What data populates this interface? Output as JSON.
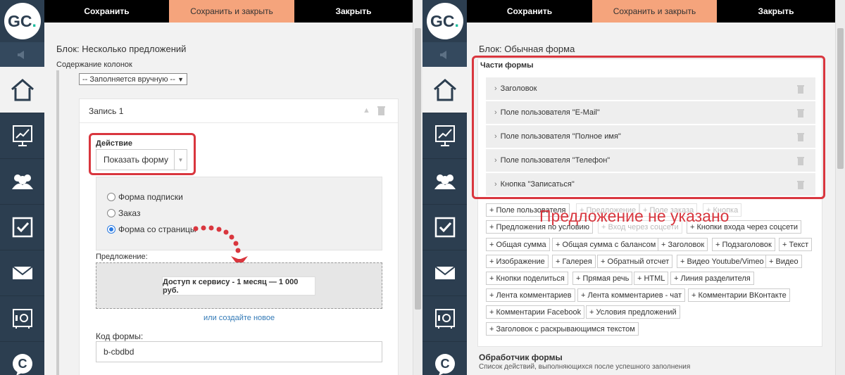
{
  "left": {
    "logo": "GC.",
    "toolbar": {
      "save": "Сохранить",
      "save_close": "Сохранить и закрыть",
      "close": "Закрыть"
    },
    "block_title": "Блок: Несколько предложений",
    "columns_label": "Содержание колонок",
    "columns_select": "-- Заполняется вручную --",
    "record_title": "Запись 1",
    "action_label": "Действие",
    "action_value": "Показать форму",
    "radio_options": [
      "Форма подписки",
      "Заказ",
      "Форма со страницы"
    ],
    "radio_selected": "Форма со страницы",
    "offer_label": "Предложение:",
    "offer_value": "Доступ к сервису - 1 месяц — 1 000 руб.",
    "create_new_link": "или создайте новое",
    "form_code_label": "Код формы:",
    "form_code_value": "b-cbdbd"
  },
  "right": {
    "logo": "GC.",
    "toolbar": {
      "save": "Сохранить",
      "save_close": "Сохранить и закрыть",
      "close": "Закрыть"
    },
    "block_title": "Блок: Обычная форма",
    "form_parts_label": "Части формы",
    "form_parts": [
      "Заголовок",
      "Поле пользователя \"E-Mail\"",
      "Поле пользователя \"Полное имя\"",
      "Поле пользователя \"Телефон\"",
      "Кнопка \"Записаться\""
    ],
    "add_tags": [
      "+ Поле пользователя",
      "+ Предложение",
      "+ Поле заказа",
      "+ Кнопка",
      "+ Предложения по условию",
      "+ Вход через соцсети",
      "+ Кнопки входа через соцсети",
      "+ Общая сумма",
      "+ Общая сумма с балансом",
      "+ Заголовок",
      "+ Подзаголовок",
      "+ Текст",
      "+ Изображение",
      "+ Галерея",
      "+ Обратный отсчет",
      "+ Видео Youtube/Vimeo",
      "+ Видео",
      "+ Кнопки поделиться",
      "+ Прямая речь",
      "+ HTML",
      "+ Линия разделителя",
      "+ Лента комментариев",
      "+ Лента комментариев - чат",
      "+ Комментарии ВКонтакте",
      "+ Комментарии Facebook",
      "+ Условия предложений",
      "+ Заголовок с раскрывающимся текстом"
    ],
    "overlay_note": "Предложение не указано",
    "handler_title": "Обработчик формы",
    "handler_subtitle": "Список действий, выполняющихся после успешного заполнения"
  },
  "colors": {
    "sidebar": "#2c3e50",
    "accent_orange": "#f5a47c",
    "highlight_red": "#d9363e",
    "link_blue": "#337ab7"
  }
}
